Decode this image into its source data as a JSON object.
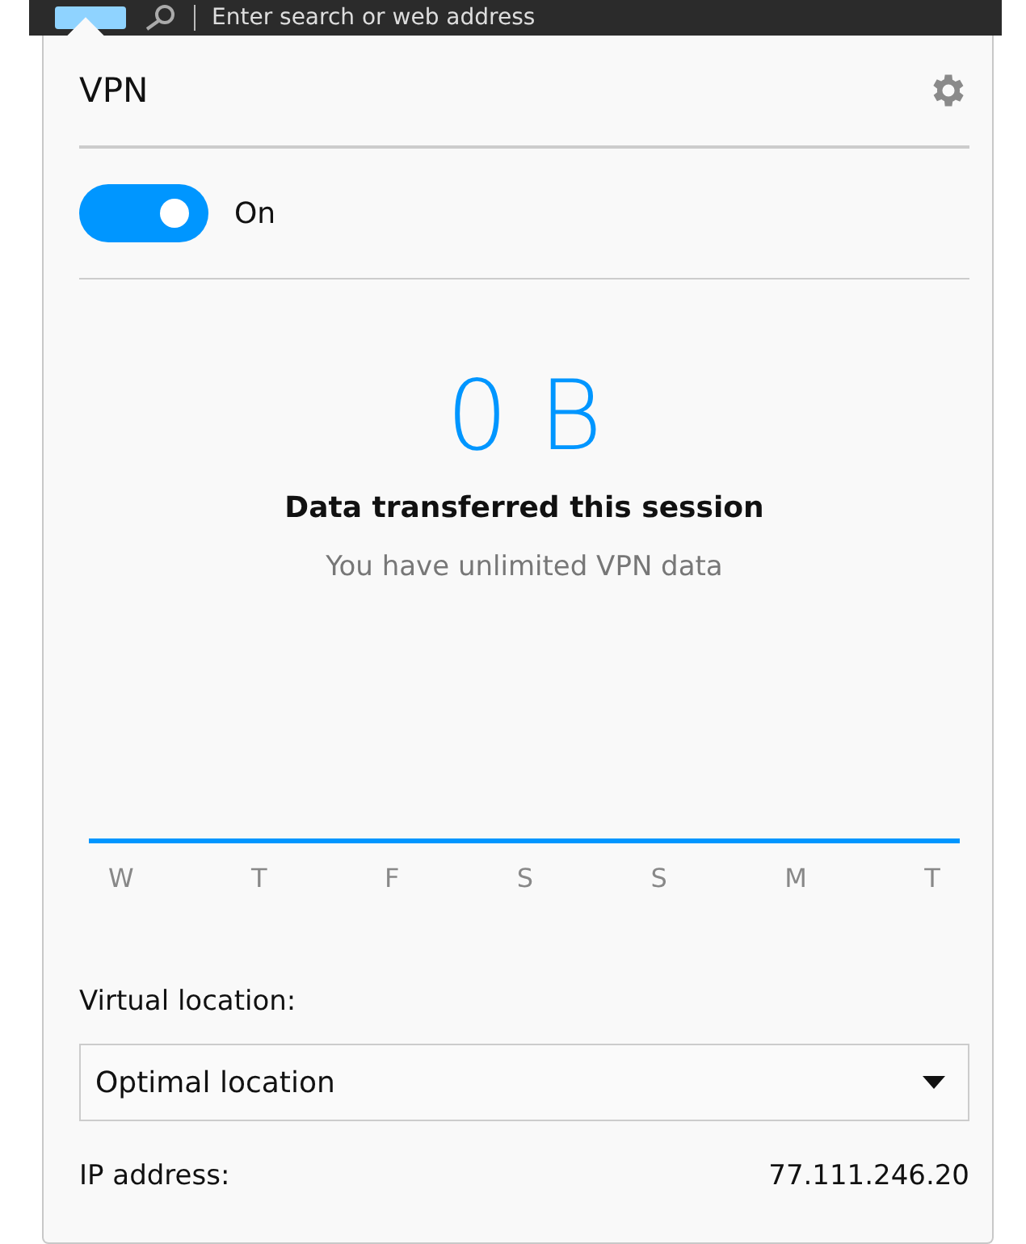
{
  "browser_bar": {
    "address_placeholder": "Enter search or web address"
  },
  "popup": {
    "title": "VPN",
    "toggle": {
      "on": true,
      "label": "On"
    },
    "data_amount": "0 B",
    "data_caption": "Data transferred this session",
    "data_note": "You have unlimited VPN data",
    "days": [
      "W",
      "T",
      "F",
      "S",
      "S",
      "M",
      "T"
    ],
    "location_label": "Virtual location:",
    "location_select": {
      "value": "Optimal location"
    },
    "ip_label": "IP address:",
    "ip_value": "77.111.246.20"
  }
}
